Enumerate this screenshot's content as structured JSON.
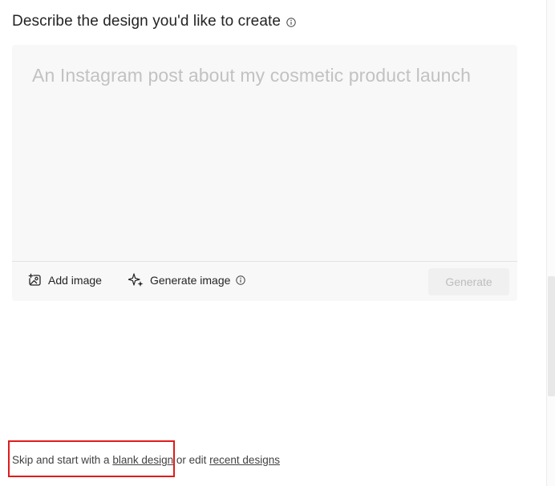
{
  "header": {
    "title": "Describe the design you'd like to create",
    "info_icon": "info-icon"
  },
  "prompt": {
    "placeholder": "An Instagram post about my cosmetic product launch",
    "value": ""
  },
  "toolbar": {
    "add_image_label": "Add image",
    "add_image_icon": "image-add-icon",
    "generate_image_label": "Generate image",
    "generate_image_icon": "sparkle-icon",
    "generate_image_info_icon": "info-icon",
    "generate_label": "Generate",
    "generate_enabled": false
  },
  "footer": {
    "prefix": "Skip and start with a ",
    "blank_design_link": "blank design",
    "middle": " or edit ",
    "recent_designs_link": "recent designs"
  },
  "colors": {
    "highlight": "#e01b1b",
    "text": "#242424",
    "placeholder": "#c2c2c2",
    "panel_bg": "#f8f8f8"
  }
}
